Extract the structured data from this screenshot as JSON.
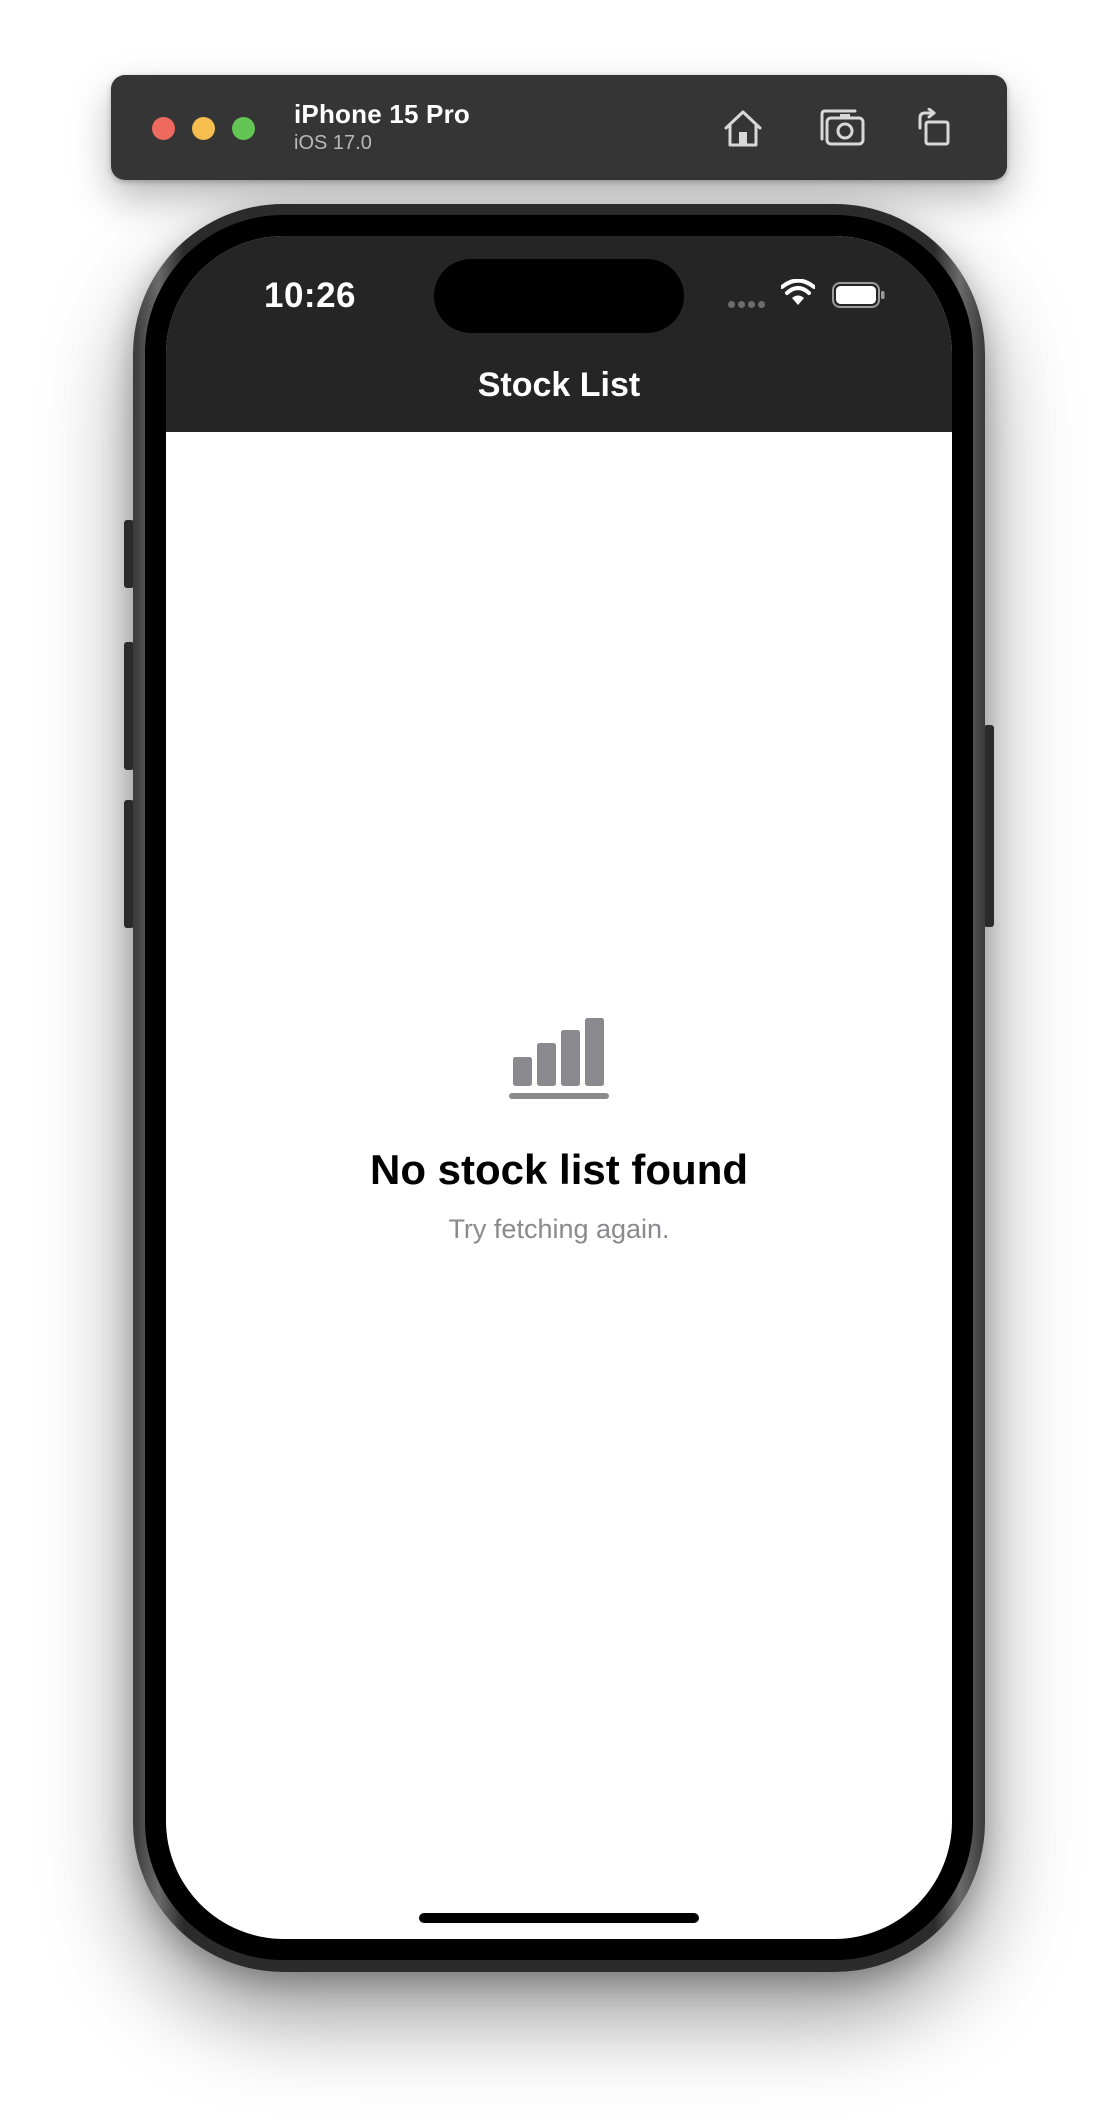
{
  "simulator": {
    "device_name": "iPhone 15 Pro",
    "os_version": "iOS 17.0",
    "buttons": [
      {
        "id": "home",
        "icon": "home-icon"
      },
      {
        "id": "screenshot",
        "icon": "camera-icon"
      },
      {
        "id": "rotate",
        "icon": "rotate-icon"
      }
    ]
  },
  "status_bar": {
    "time": "10:26",
    "icons": [
      "cellular-signal-icon",
      "wifi-icon",
      "battery-icon"
    ]
  },
  "nav": {
    "title": "Stock List"
  },
  "empty_state": {
    "icon": "chart-bar-icon",
    "title": "No stock list found",
    "subtitle": "Try fetching again."
  },
  "colors": {
    "nav_background": "#252525",
    "icon_gray": "#8a8a8e",
    "traffic_red": "#ee6a5f",
    "traffic_yellow": "#f5be4f",
    "traffic_green": "#62c554"
  }
}
